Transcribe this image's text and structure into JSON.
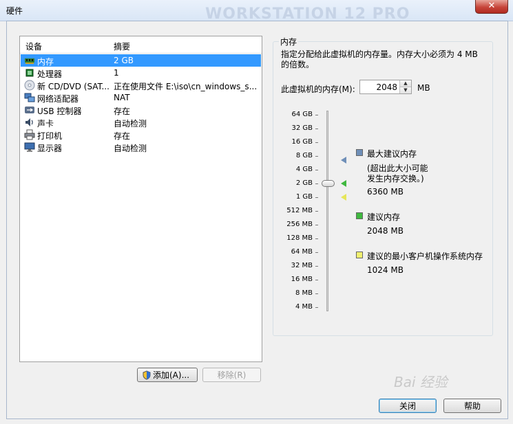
{
  "window": {
    "title": "硬件",
    "ghost_text": "WORKSTATION 12 PRO",
    "close_label": "✕"
  },
  "devices": {
    "col_device": "设备",
    "col_summary": "摘要",
    "rows": [
      {
        "name": "内存",
        "summary": "2 GB",
        "icon": "memory-icon",
        "selected": true
      },
      {
        "name": "处理器",
        "summary": "1",
        "icon": "processor-icon",
        "selected": false
      },
      {
        "name": "新 CD/DVD (SAT...",
        "summary": "正在使用文件 E:\\iso\\cn_windows_s...",
        "icon": "cd-dvd-icon",
        "selected": false
      },
      {
        "name": "网络适配器",
        "summary": "NAT",
        "icon": "network-adapter-icon",
        "selected": false
      },
      {
        "name": "USB 控制器",
        "summary": "存在",
        "icon": "usb-icon",
        "selected": false
      },
      {
        "name": "声卡",
        "summary": "自动检测",
        "icon": "sound-card-icon",
        "selected": false
      },
      {
        "name": "打印机",
        "summary": "存在",
        "icon": "printer-icon",
        "selected": false
      },
      {
        "name": "显示器",
        "summary": "自动检测",
        "icon": "display-icon",
        "selected": false
      }
    ]
  },
  "buttons": {
    "add": "添加(A)...",
    "remove": "移除(R)",
    "close": "关闭",
    "help": "帮助"
  },
  "memory": {
    "group_title": "内存",
    "description": "指定分配给此虚拟机的内存量。内存大小必须为 4 MB 的倍数。",
    "label": "此虚拟机的内存(M):",
    "value": "2048",
    "unit": "MB",
    "scale": [
      "64 GB",
      "32 GB",
      "16 GB",
      "8 GB",
      "4 GB",
      "2 GB",
      "1 GB",
      "512 MB",
      "256 MB",
      "128 MB",
      "64 MB",
      "32 MB",
      "16 MB",
      "8 MB",
      "4 MB"
    ],
    "max_recommended": {
      "title": "最大建议内存",
      "note_line1": "(超出此大小可能",
      "note_line2": "发生内存交换。)",
      "value": "6360 MB",
      "color": "#6f8fb8"
    },
    "recommended": {
      "title": "建议内存",
      "value": "2048 MB",
      "color": "#3fb83f"
    },
    "min_guest": {
      "title": "建议的最小客户机操作系统内存",
      "value": "1024 MB",
      "color": "#f0f070"
    }
  },
  "watermark": "Bai 经验"
}
